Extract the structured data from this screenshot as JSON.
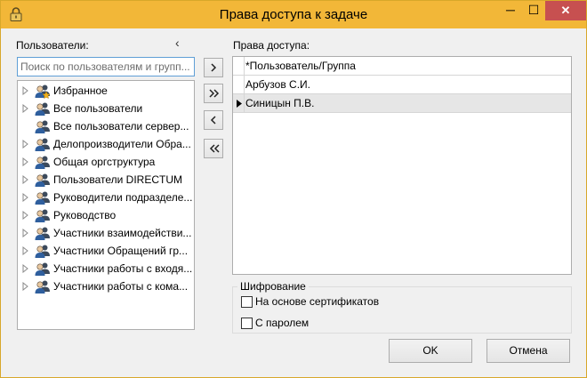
{
  "window": {
    "title": "Права доступа к задаче",
    "close_glyph": "✕",
    "minimize_glyph": "─",
    "maximize_glyph": "☐",
    "icon": "lock-icon"
  },
  "left_panel": {
    "label": "Пользователи:",
    "search_placeholder": "Поиск по пользователям и групп...",
    "collapse_icon": "chevron-left-icon",
    "items": [
      {
        "label": "Избранное",
        "icon": "favorites-users-icon",
        "expandable": true
      },
      {
        "label": "Все пользователи",
        "icon": "users-group-icon",
        "expandable": true
      },
      {
        "label": "Все пользователи сервер...",
        "icon": "users-group-icon",
        "expandable": false
      },
      {
        "label": "Делопроизводители Обра...",
        "icon": "users-group-icon",
        "expandable": true
      },
      {
        "label": "Общая оргструктура",
        "icon": "users-group-icon",
        "expandable": true
      },
      {
        "label": "Пользователи DIRECTUM",
        "icon": "users-group-icon",
        "expandable": true
      },
      {
        "label": "Руководители подразделе...",
        "icon": "users-group-icon",
        "expandable": true
      },
      {
        "label": "Руководство",
        "icon": "users-group-icon",
        "expandable": true
      },
      {
        "label": "Участники взаимодействи...",
        "icon": "users-group-icon",
        "expandable": true
      },
      {
        "label": "Участники Обращений гр...",
        "icon": "users-group-icon",
        "expandable": true
      },
      {
        "label": "Участники работы с входя...",
        "icon": "users-group-icon",
        "expandable": true
      },
      {
        "label": "Участники работы с кома...",
        "icon": "users-group-icon",
        "expandable": true
      }
    ]
  },
  "move_buttons": [
    {
      "name": "add-selected-button",
      "icon": "chevron-right-icon"
    },
    {
      "name": "add-all-button",
      "icon": "double-chevron-right-icon"
    },
    {
      "name": "remove-selected-button",
      "icon": "chevron-left-icon"
    },
    {
      "name": "remove-all-button",
      "icon": "double-chevron-left-icon"
    }
  ],
  "right_panel": {
    "label": "Права доступа:",
    "column_header": "*Пользователь/Группа",
    "rows": [
      {
        "value": "Арбузов С.И.",
        "selected": false
      },
      {
        "value": "Синицын П.В.",
        "selected": true
      }
    ]
  },
  "encryption": {
    "title": "Шифрование",
    "options": [
      {
        "label": "На основе сертификатов",
        "checked": false
      },
      {
        "label": "С паролем",
        "checked": false
      }
    ]
  },
  "buttons": {
    "ok": "OK",
    "cancel": "Отмена"
  },
  "colors": {
    "titlebar": "#f2b738",
    "close": "#c75050",
    "search_border": "#5f9fd6",
    "selected_row": "#e6e6e6"
  }
}
